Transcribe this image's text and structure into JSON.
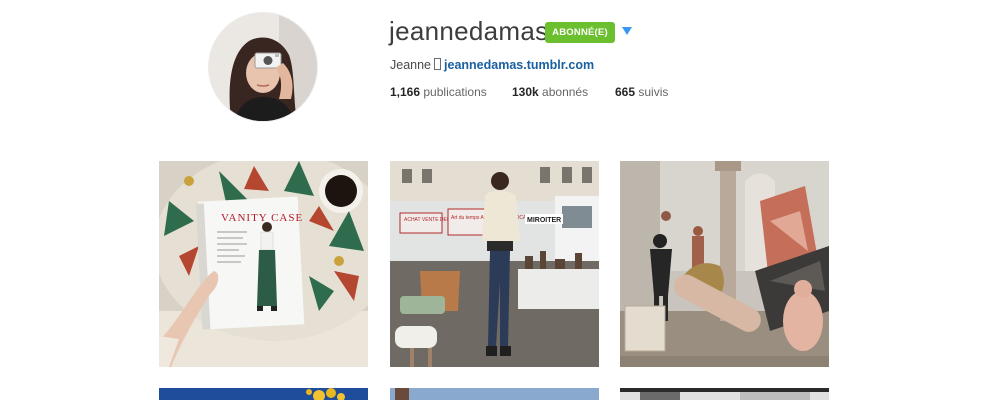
{
  "profile": {
    "username": "jeannedamas",
    "follow_button_label": "ABONNÉ(E)",
    "bio_name": "Jeanne",
    "bio_link": "jeannedamas.tumblr.com",
    "stats": {
      "posts_count": "1,166",
      "posts_label": "publications",
      "followers_count": "130k",
      "followers_label": "abonnés",
      "following_count": "665",
      "following_label": "suivis"
    }
  },
  "posts": {
    "first_row": {
      "magazine_title": "VANITY CASE",
      "market_sign_1": "ACHAT VENTE DEBARRAS",
      "market_sign_2": "Art du temps ANTIQUITÉ BROCANTE",
      "market_sign_3": "MIROITER"
    }
  },
  "colors": {
    "follow_green": "#6cbf2f",
    "link_blue": "#1a5fa0",
    "caret_blue": "#3897f0"
  }
}
